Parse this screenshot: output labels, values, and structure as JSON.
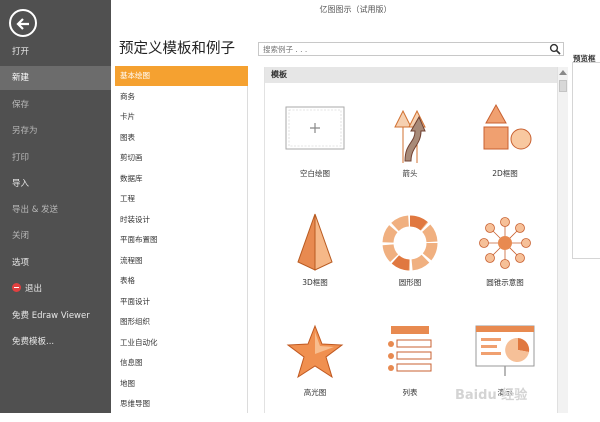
{
  "app_title": "亿图图示（试用版）",
  "heading": "预定义模板和例子",
  "search": {
    "placeholder": "搜索例子 . . ."
  },
  "preview_label": "预览框",
  "sidebar": {
    "items": [
      {
        "label": "打开"
      },
      {
        "label": "新建"
      },
      {
        "label": "保存"
      },
      {
        "label": "另存为"
      },
      {
        "label": "打印"
      },
      {
        "label": "导入"
      },
      {
        "label": "导出 & 发送"
      },
      {
        "label": "关闭"
      },
      {
        "label": "选项"
      },
      {
        "label": "退出"
      },
      {
        "label": "免费 Edraw Viewer"
      },
      {
        "label": "免费模板..."
      }
    ]
  },
  "categories": [
    "基本绘图",
    "商务",
    "卡片",
    "图表",
    "剪切画",
    "数据库",
    "工程",
    "时装设计",
    "平面布置图",
    "流程图",
    "表格",
    "平面设计",
    "图形组织",
    "工业自动化",
    "信息图",
    "地图",
    "思维导图"
  ],
  "template_section": "模板",
  "templates": [
    {
      "label": "空白绘图",
      "icon": "blank-canvas-icon"
    },
    {
      "label": "箭头",
      "icon": "arrows-icon"
    },
    {
      "label": "2D框图",
      "icon": "2d-shapes-icon"
    },
    {
      "label": "3D框图",
      "icon": "3d-pyramid-icon"
    },
    {
      "label": "圆形图",
      "icon": "circle-chart-icon"
    },
    {
      "label": "圆锥示意图",
      "icon": "radial-diagram-icon"
    },
    {
      "label": "高光图",
      "icon": "star-icon"
    },
    {
      "label": "列表",
      "icon": "list-icon"
    },
    {
      "label": "演示",
      "icon": "presentation-icon"
    }
  ],
  "colors": {
    "accent": "#f5a130",
    "sidebar_bg": "#505050",
    "shape_fill": "#f0a070"
  },
  "watermark": "Baidu 经验"
}
